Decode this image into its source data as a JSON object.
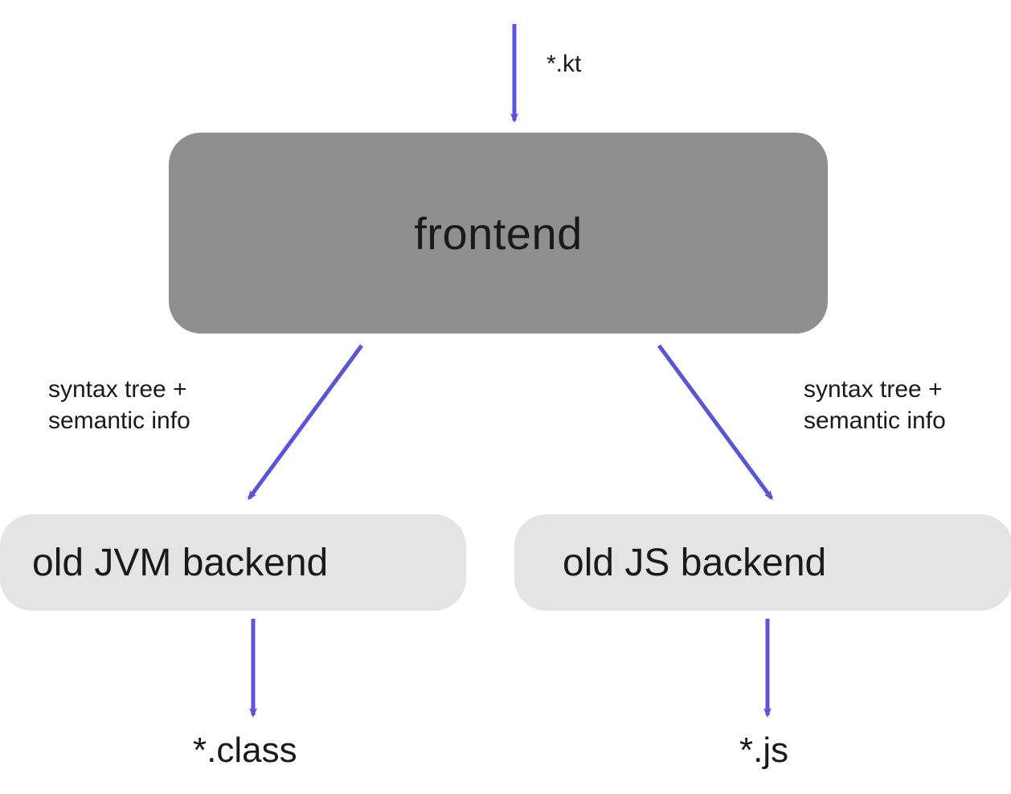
{
  "colors": {
    "arrow": "#5a55d6",
    "frontend_bg": "#8f8f8f",
    "backend_bg": "#e4e4e4"
  },
  "nodes": {
    "frontend": "frontend",
    "jvm_backend": "old JVM backend",
    "js_backend": "old JS backend"
  },
  "inputs": {
    "source": "*.kt"
  },
  "edges": {
    "to_jvm": "syntax tree + semantic info",
    "to_js": "syntax tree + semantic info"
  },
  "outputs": {
    "jvm": "*.class",
    "js": "*.js"
  }
}
